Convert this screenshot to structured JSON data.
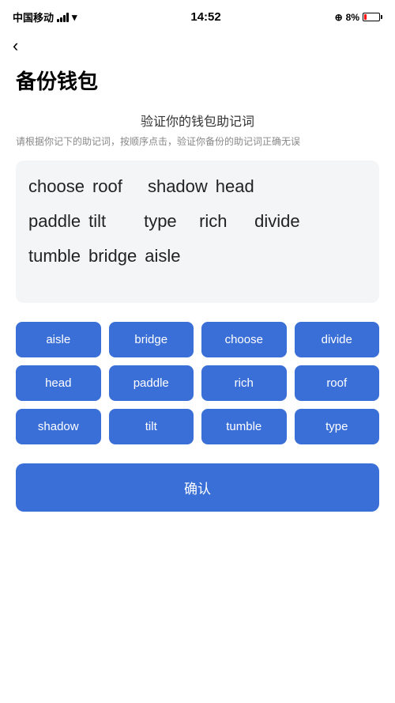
{
  "statusBar": {
    "carrier": "中国移动",
    "time": "14:52",
    "batteryPercent": "8%",
    "wifi": true
  },
  "backButton": "‹",
  "pageTitle": "备份钱包",
  "subtitle": {
    "title": "验证你的钱包助记词",
    "description": "请根据你记下的助记词，按顺序点击，验证你备份的助记词正确无误"
  },
  "displayWords": {
    "row1": [
      "choose",
      "roof",
      "shadow",
      "head"
    ],
    "row2": [
      "paddle",
      "tilt",
      "type",
      "rich",
      "divide"
    ],
    "row3": [
      "tumble",
      "bridge",
      "aisle"
    ]
  },
  "wordButtons": [
    "aisle",
    "bridge",
    "choose",
    "divide",
    "head",
    "paddle",
    "rich",
    "roof",
    "shadow",
    "tilt",
    "tumble",
    "type"
  ],
  "confirmButton": "确认"
}
